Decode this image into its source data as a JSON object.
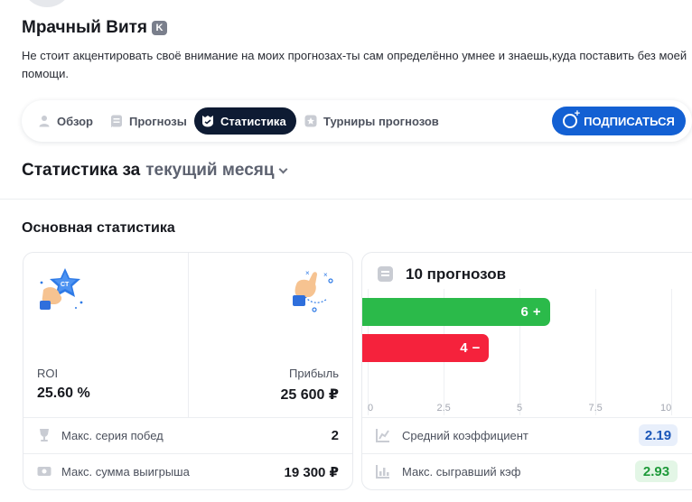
{
  "profile": {
    "name": "Мрачный Витя",
    "badge": "K",
    "bio": "Не стоит акцентировать своё внимание на моих прогнозах-ты сам определённо умнее и знаешь,куда поставить без моей помощи."
  },
  "tabs": [
    {
      "label": "Обзор",
      "icon": "person-icon",
      "active": false
    },
    {
      "label": "Прогнозы",
      "icon": "list-icon",
      "active": false
    },
    {
      "label": "Статистика",
      "icon": "stats-shield-icon",
      "active": true
    },
    {
      "label": "Турниры прогнозов",
      "icon": "tournament-icon",
      "active": false
    }
  ],
  "subscribe_label": "ПОДПИСАТЬСЯ",
  "stats_header": {
    "prefix": "Статистика за",
    "period": "текущий месяц"
  },
  "main_title": "Основная статистика",
  "summary": {
    "roi_label": "ROI",
    "roi_value": "25.60 %",
    "profit_label": "Прибыль",
    "profit_value": "25 600 ₽",
    "rows": [
      {
        "label": "Макс. серия побед",
        "value": "2",
        "icon": "trophy-icon"
      },
      {
        "label": "Макс. сумма выигрыша",
        "value": "19 300 ₽",
        "icon": "cash-icon"
      }
    ]
  },
  "forecast": {
    "title": "10 прогнозов",
    "win_label": "6",
    "win_sign": "+",
    "loss_label": "4",
    "loss_sign": "−",
    "ticks": [
      "0",
      "2.5",
      "5",
      "7.5",
      "10"
    ],
    "rows": [
      {
        "label": "Средний коэффициент",
        "value": "2.19",
        "icon": "chart-icon"
      },
      {
        "label": "Макс. сыгравший кэф",
        "value": "2.93",
        "icon": "bar-chart-icon"
      }
    ]
  },
  "chart_data": {
    "type": "bar",
    "orientation": "horizontal",
    "categories": [
      "+",
      "−"
    ],
    "values": [
      6,
      4
    ],
    "xlim": [
      0,
      10
    ],
    "ticks": [
      0,
      2.5,
      5,
      7.5,
      10
    ],
    "colors": [
      "#2bba4a",
      "#f5223c"
    ]
  },
  "colors": {
    "accent": "#1360d3",
    "active_tab": "#0e1b33",
    "win": "#2bba4a",
    "loss": "#f5223c"
  }
}
